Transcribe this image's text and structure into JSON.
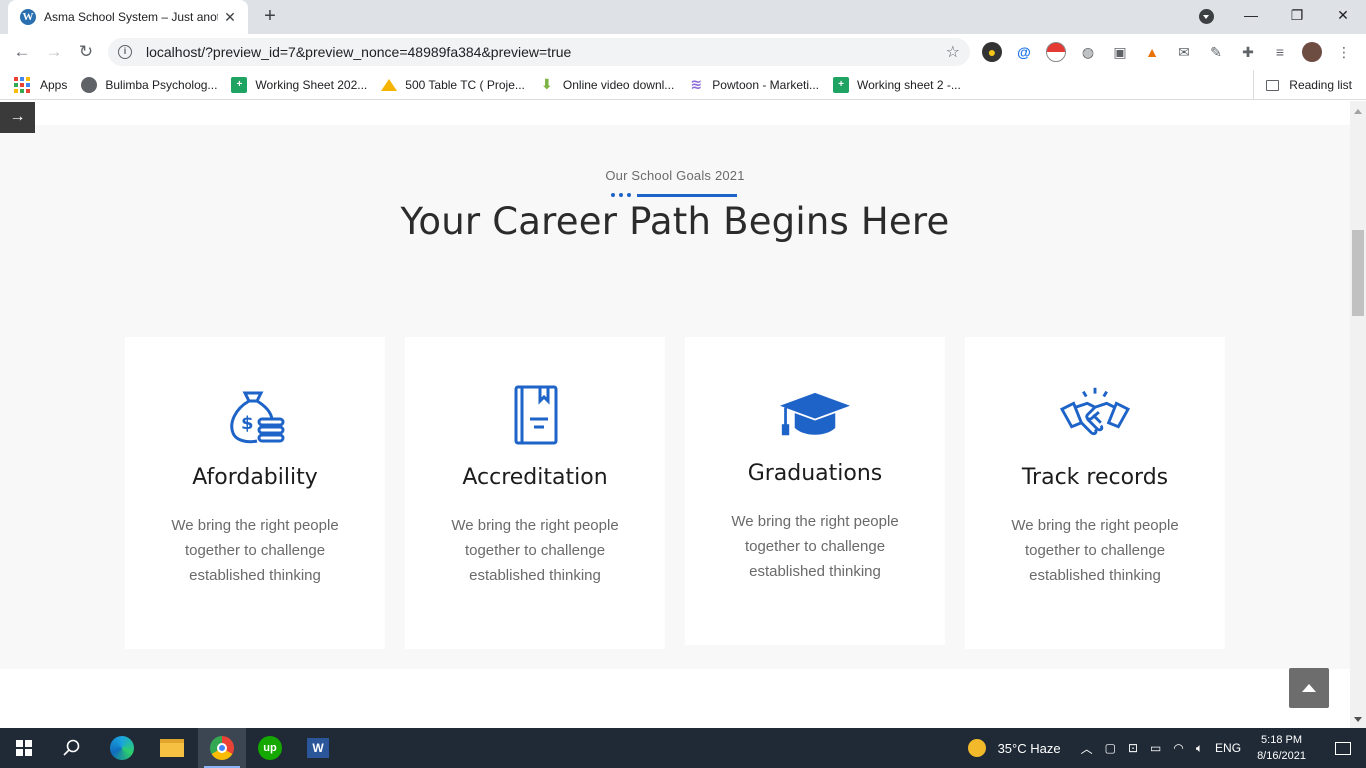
{
  "browser": {
    "tab_title": "Asma School System – Just anoth",
    "url": "localhost/?preview_id=7&preview_nonce=48989fa384&preview=true",
    "new_tab_symbol": "+",
    "close_symbol": "✕",
    "win_minimize": "—",
    "win_maximize": "❐",
    "win_close": "✕"
  },
  "bookmarks": {
    "apps": "Apps",
    "items": [
      {
        "label": "Bulimba Psycholog...",
        "color": "#5f6368",
        "icon": "globe-icon"
      },
      {
        "label": "Working Sheet 202...",
        "color": "#1ea362",
        "icon": "sheets-icon"
      },
      {
        "label": "500 Table TC ( Proje...",
        "color": "#f4b400",
        "icon": "drive-icon"
      },
      {
        "label": "Online video downl...",
        "color": "#7cb342",
        "icon": "download-icon"
      },
      {
        "label": "Powtoon - Marketi...",
        "color": "#8e6bd8",
        "icon": "powtoon-icon"
      },
      {
        "label": "Working sheet 2 -...",
        "color": "#1ea362",
        "icon": "sheets-icon"
      }
    ],
    "reading_list": "Reading list"
  },
  "page": {
    "eyebrow": "Our School Goals 2021",
    "heading": "Your Career Path Begins Here",
    "accent_color": "#1e63c7",
    "cards": [
      {
        "title": "Afordability",
        "text": "We bring the right people together to challenge established thinking",
        "icon": "money-bag-icon"
      },
      {
        "title": "Accreditation",
        "text": "We bring the right people together to challenge established thinking",
        "icon": "book-icon"
      },
      {
        "title": "Graduations",
        "text": "We bring the right people together to challenge established thinking",
        "icon": "graduation-cap-icon"
      },
      {
        "title": "Track records",
        "text": "We bring the right people together to challenge established thinking",
        "icon": "handshake-icon"
      }
    ]
  },
  "taskbar": {
    "weather": "35°C  Haze",
    "language": "ENG",
    "time": "5:18 PM",
    "date": "8/16/2021"
  }
}
